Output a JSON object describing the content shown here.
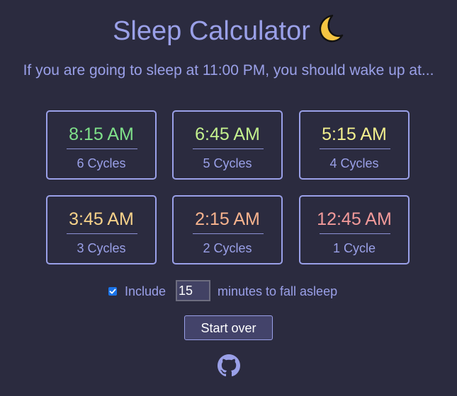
{
  "header": {
    "title": "Sleep Calculator",
    "moon_emoji": "🌙"
  },
  "subtitle": "If you are going to sleep at 11:00 PM, you should wake up at...",
  "results": [
    {
      "time": "8:15 AM",
      "cycles": "6 Cycles",
      "color": "#7fe08a"
    },
    {
      "time": "6:45 AM",
      "cycles": "5 Cycles",
      "color": "#c3f08e"
    },
    {
      "time": "5:15 AM",
      "cycles": "4 Cycles",
      "color": "#f2ef8e"
    },
    {
      "time": "3:45 AM",
      "cycles": "3 Cycles",
      "color": "#f7d28a"
    },
    {
      "time": "2:15 AM",
      "cycles": "2 Cycles",
      "color": "#f7b38e"
    },
    {
      "time": "12:45 AM",
      "cycles": "1 Cycle",
      "color": "#f29a9a"
    }
  ],
  "options": {
    "include_checked": true,
    "include_label": "Include",
    "minutes_value": "15",
    "minutes_label": "minutes to fall asleep"
  },
  "actions": {
    "start_over_label": "Start over"
  },
  "footer": {
    "icon": "github-icon"
  },
  "colors": {
    "background": "#2b2b3f",
    "accent": "#9aa0e8",
    "checkbox": "#1a73e8"
  }
}
